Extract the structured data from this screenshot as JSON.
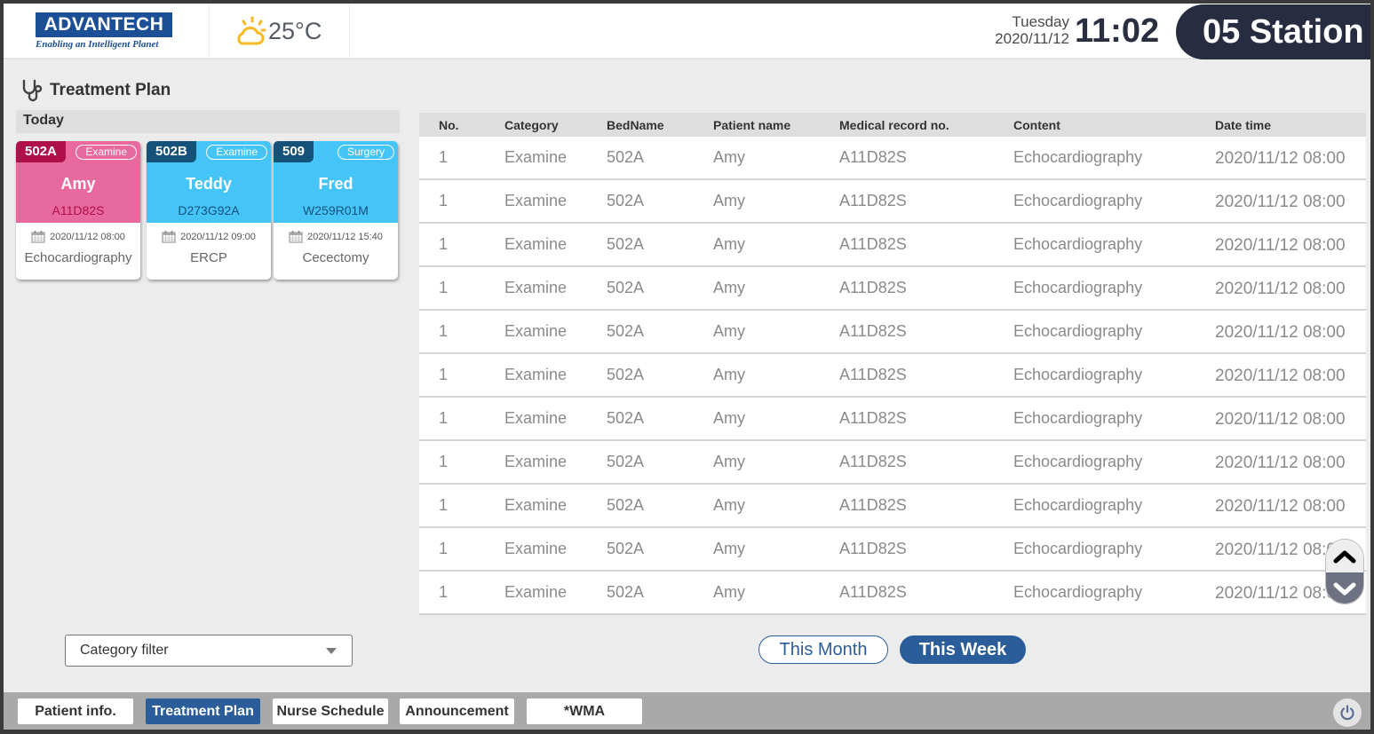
{
  "header": {
    "logo_text": "ADVANTECH",
    "logo_tagline": "Enabling an Intelligent Planet",
    "weather_icon": "partly-cloudy-icon",
    "temperature": "25°C",
    "weekday": "Tuesday",
    "date": "2020/11/12",
    "time": "11:02",
    "station": "05 Station"
  },
  "page": {
    "title": "Treatment Plan",
    "title_icon": "stethoscope-icon"
  },
  "today": {
    "label": "Today",
    "cards": [
      {
        "bed": "502A",
        "category": "Examine",
        "name": "Amy",
        "mrn": "A11D82S",
        "datetime": "2020/11/12 08:00",
        "content": "Echocardiography",
        "color": "#e8699e",
        "badge_color": "#b0104a",
        "mrn_color": "#b0104a"
      },
      {
        "bed": "502B",
        "category": "Examine",
        "name": "Teddy",
        "mrn": "D273G92A",
        "datetime": "2020/11/12 09:00",
        "content": "ERCP",
        "color": "#45c4f8",
        "badge_color": "#14527a",
        "mrn_color": "#14527a"
      },
      {
        "bed": "509",
        "category": "Surgery",
        "name": "Fred",
        "mrn": "W259R01M",
        "datetime": "2020/11/12 15:40",
        "content": "Cecectomy",
        "color": "#45c4f8",
        "badge_color": "#14527a",
        "mrn_color": "#14527a"
      }
    ]
  },
  "table": {
    "columns": [
      "No.",
      "Category",
      "BedName",
      "Patient name",
      "Medical record no.",
      "Content",
      "Date time"
    ],
    "rows": [
      [
        "1",
        "Examine",
        "502A",
        "Amy",
        "A11D82S",
        "Echocardiography",
        "2020/11/12 08:00"
      ],
      [
        "1",
        "Examine",
        "502A",
        "Amy",
        "A11D82S",
        "Echocardiography",
        "2020/11/12 08:00"
      ],
      [
        "1",
        "Examine",
        "502A",
        "Amy",
        "A11D82S",
        "Echocardiography",
        "2020/11/12 08:00"
      ],
      [
        "1",
        "Examine",
        "502A",
        "Amy",
        "A11D82S",
        "Echocardiography",
        "2020/11/12 08:00"
      ],
      [
        "1",
        "Examine",
        "502A",
        "Amy",
        "A11D82S",
        "Echocardiography",
        "2020/11/12 08:00"
      ],
      [
        "1",
        "Examine",
        "502A",
        "Amy",
        "A11D82S",
        "Echocardiography",
        "2020/11/12 08:00"
      ],
      [
        "1",
        "Examine",
        "502A",
        "Amy",
        "A11D82S",
        "Echocardiography",
        "2020/11/12 08:00"
      ],
      [
        "1",
        "Examine",
        "502A",
        "Amy",
        "A11D82S",
        "Echocardiography",
        "2020/11/12 08:00"
      ],
      [
        "1",
        "Examine",
        "502A",
        "Amy",
        "A11D82S",
        "Echocardiography",
        "2020/11/12 08:00"
      ],
      [
        "1",
        "Examine",
        "502A",
        "Amy",
        "A11D82S",
        "Echocardiography",
        "2020/11/12 08:00"
      ],
      [
        "1",
        "Examine",
        "502A",
        "Amy",
        "A11D82S",
        "Echocardiography",
        "2020/11/12 08:00"
      ]
    ]
  },
  "controls": {
    "category_filter": "Category filter",
    "this_month": "This Month",
    "this_week": "This Week",
    "selected_range": "This Week"
  },
  "nav": {
    "items": [
      {
        "label": "Patient info.",
        "active": false
      },
      {
        "label": "Treatment Plan",
        "active": true
      },
      {
        "label": "Nurse Schedule",
        "active": false
      },
      {
        "label": "Announcement",
        "active": false
      },
      {
        "label": "*WMA",
        "active": false
      }
    ],
    "power_icon": "power-icon"
  },
  "colors": {
    "accent": "#2a5d9a",
    "station_bg": "#272c41",
    "weather_icon": "#f7b924"
  }
}
